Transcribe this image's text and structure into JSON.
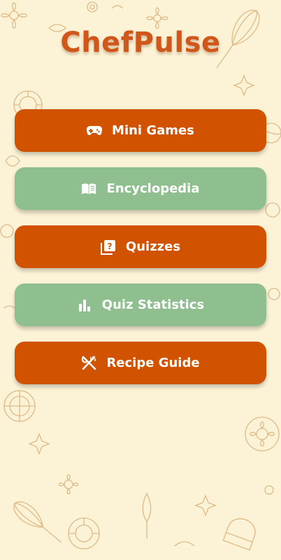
{
  "app": {
    "title": "ChefPulse"
  },
  "theme": {
    "background": "#fcf3d6",
    "primary": "#d15200",
    "secondary": "#8fbf8e",
    "title_color": "#d1561a",
    "doodle_color": "#d8b07a"
  },
  "menu": {
    "items": [
      {
        "label": "Mini Games",
        "icon": "gamepad-icon",
        "style": "primary"
      },
      {
        "label": "Encyclopedia",
        "icon": "book-icon",
        "style": "secondary"
      },
      {
        "label": "Quizzes",
        "icon": "quiz-icon",
        "style": "primary"
      },
      {
        "label": "Quiz Statistics",
        "icon": "bar-chart-icon",
        "style": "secondary"
      },
      {
        "label": "Recipe Guide",
        "icon": "utensils-icon",
        "style": "primary"
      }
    ]
  }
}
